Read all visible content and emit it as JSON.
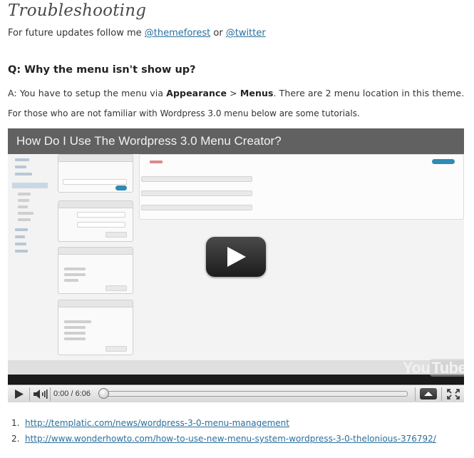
{
  "heading": "Troubleshooting",
  "follow": {
    "prefix": "For future updates follow me ",
    "link1": "@themeforest",
    "middle": " or ",
    "link2": "@twitter"
  },
  "question": "Q: Why the menu isn't show up?",
  "answer": {
    "prefix": "A: You have to setup the menu via ",
    "bold1": "Appearance",
    "sep": " > ",
    "bold2": "Menus",
    "suffix": ". There are 2 menu location in this theme."
  },
  "intro": "For those who are not familiar with Wordpress 3.0 menu below are some tutorials.",
  "video": {
    "title": "How Do I Use The Wordpress 3.0 Menu Creator?",
    "time": "0:00 / 6:06",
    "progress": 0,
    "logo_a": "You",
    "logo_b": "Tube",
    "icons": [
      "play-icon",
      "volume-icon",
      "expand-up-icon",
      "fullscreen-icon"
    ]
  },
  "links": [
    {
      "num": "1.",
      "text": "http://templatic.com/news/wordpress-3-0-menu-management"
    },
    {
      "num": "2.",
      "text": "http://www.wonderhowto.com/how-to-use-new-menu-system-wordpress-3-0-thelonious-376792/"
    }
  ],
  "colors": {
    "link": "#2a6f9c",
    "video_bg": "#0d0d0d",
    "play_button": "#2a2a2a"
  }
}
